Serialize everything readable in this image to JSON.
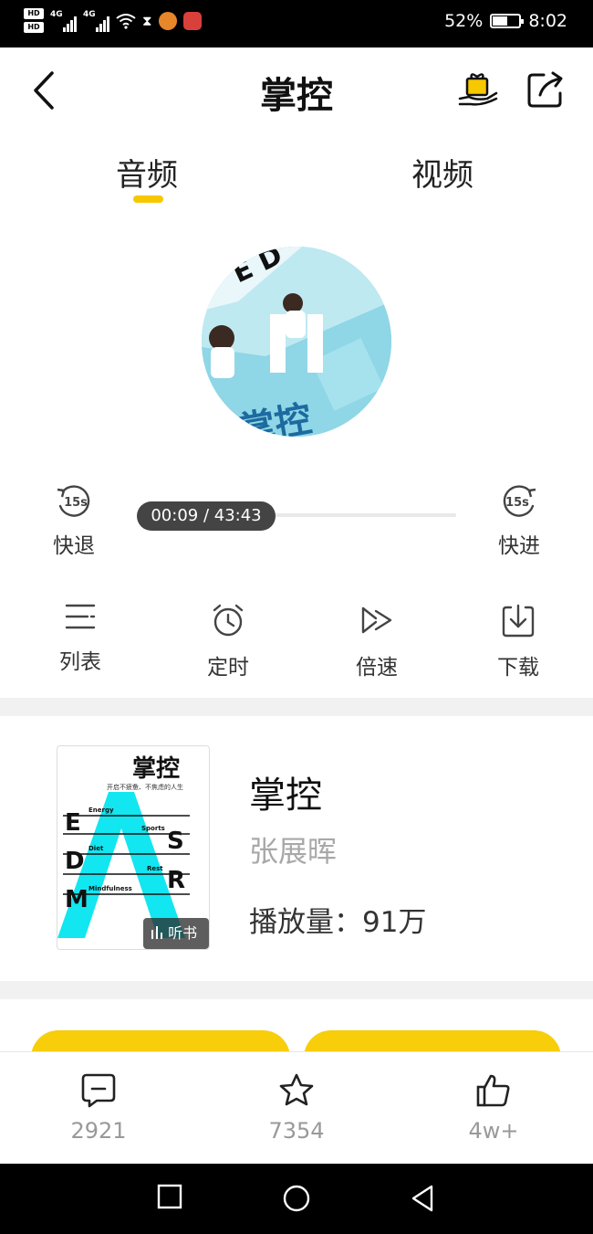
{
  "status_bar": {
    "left_labels": [
      "HD",
      "HD",
      "4G",
      "4G"
    ],
    "battery_percent": "52%",
    "time": "8:02"
  },
  "header": {
    "title": "掌控",
    "back_icon": "chevron-left-icon",
    "gift_icon": "gift-icon",
    "share_icon": "share-icon"
  },
  "tabs": [
    {
      "label": "音频",
      "active": true
    },
    {
      "label": "视频",
      "active": false
    }
  ],
  "accent_color": "#f7c800",
  "player": {
    "state": "playing",
    "rewind_icon_text": "15s",
    "rewind_label": "快退",
    "forward_icon_text": "15s",
    "forward_label": "快进",
    "time_display": "00:09 / 43:43",
    "elapsed_seconds": 9,
    "duration_seconds": 2623
  },
  "controls": [
    {
      "key": "list",
      "label": "列表",
      "icon": "playlist-icon"
    },
    {
      "key": "timer",
      "label": "定时",
      "icon": "alarm-clock-icon"
    },
    {
      "key": "speed",
      "label": "倍速",
      "icon": "speed-icon"
    },
    {
      "key": "download",
      "label": "下载",
      "icon": "download-icon"
    }
  ],
  "book": {
    "title": "掌控",
    "author": "张展晖",
    "plays": "播放量：91万",
    "cover_title": "掌控",
    "cover_subtitle": "开启不疲惫、不焦虑的人生",
    "cover_letters": [
      "E",
      "D",
      "M",
      "S",
      "R"
    ],
    "cover_words": [
      "Energy",
      "Diet",
      "Mindfulness",
      "Sports",
      "Rest"
    ],
    "badge": "听书"
  },
  "bottom_bar": {
    "comments": "2921",
    "favorites": "7354",
    "likes": "4w+"
  }
}
